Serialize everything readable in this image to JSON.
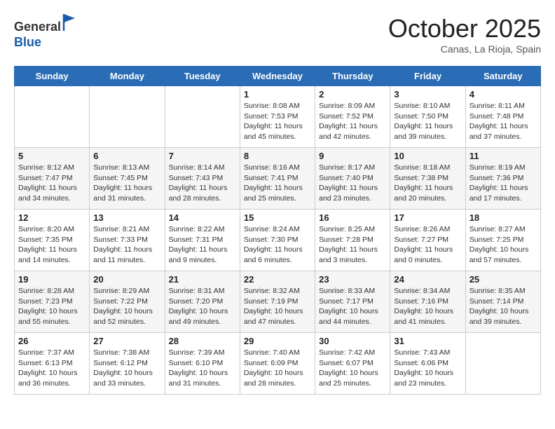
{
  "header": {
    "logo_line1": "General",
    "logo_line2": "Blue",
    "month": "October 2025",
    "location": "Canas, La Rioja, Spain"
  },
  "weekdays": [
    "Sunday",
    "Monday",
    "Tuesday",
    "Wednesday",
    "Thursday",
    "Friday",
    "Saturday"
  ],
  "weeks": [
    [
      {
        "day": "",
        "info": ""
      },
      {
        "day": "",
        "info": ""
      },
      {
        "day": "",
        "info": ""
      },
      {
        "day": "1",
        "info": "Sunrise: 8:08 AM\nSunset: 7:53 PM\nDaylight: 11 hours\nand 45 minutes."
      },
      {
        "day": "2",
        "info": "Sunrise: 8:09 AM\nSunset: 7:52 PM\nDaylight: 11 hours\nand 42 minutes."
      },
      {
        "day": "3",
        "info": "Sunrise: 8:10 AM\nSunset: 7:50 PM\nDaylight: 11 hours\nand 39 minutes."
      },
      {
        "day": "4",
        "info": "Sunrise: 8:11 AM\nSunset: 7:48 PM\nDaylight: 11 hours\nand 37 minutes."
      }
    ],
    [
      {
        "day": "5",
        "info": "Sunrise: 8:12 AM\nSunset: 7:47 PM\nDaylight: 11 hours\nand 34 minutes."
      },
      {
        "day": "6",
        "info": "Sunrise: 8:13 AM\nSunset: 7:45 PM\nDaylight: 11 hours\nand 31 minutes."
      },
      {
        "day": "7",
        "info": "Sunrise: 8:14 AM\nSunset: 7:43 PM\nDaylight: 11 hours\nand 28 minutes."
      },
      {
        "day": "8",
        "info": "Sunrise: 8:16 AM\nSunset: 7:41 PM\nDaylight: 11 hours\nand 25 minutes."
      },
      {
        "day": "9",
        "info": "Sunrise: 8:17 AM\nSunset: 7:40 PM\nDaylight: 11 hours\nand 23 minutes."
      },
      {
        "day": "10",
        "info": "Sunrise: 8:18 AM\nSunset: 7:38 PM\nDaylight: 11 hours\nand 20 minutes."
      },
      {
        "day": "11",
        "info": "Sunrise: 8:19 AM\nSunset: 7:36 PM\nDaylight: 11 hours\nand 17 minutes."
      }
    ],
    [
      {
        "day": "12",
        "info": "Sunrise: 8:20 AM\nSunset: 7:35 PM\nDaylight: 11 hours\nand 14 minutes."
      },
      {
        "day": "13",
        "info": "Sunrise: 8:21 AM\nSunset: 7:33 PM\nDaylight: 11 hours\nand 11 minutes."
      },
      {
        "day": "14",
        "info": "Sunrise: 8:22 AM\nSunset: 7:31 PM\nDaylight: 11 hours\nand 9 minutes."
      },
      {
        "day": "15",
        "info": "Sunrise: 8:24 AM\nSunset: 7:30 PM\nDaylight: 11 hours\nand 6 minutes."
      },
      {
        "day": "16",
        "info": "Sunrise: 8:25 AM\nSunset: 7:28 PM\nDaylight: 11 hours\nand 3 minutes."
      },
      {
        "day": "17",
        "info": "Sunrise: 8:26 AM\nSunset: 7:27 PM\nDaylight: 11 hours\nand 0 minutes."
      },
      {
        "day": "18",
        "info": "Sunrise: 8:27 AM\nSunset: 7:25 PM\nDaylight: 10 hours\nand 57 minutes."
      }
    ],
    [
      {
        "day": "19",
        "info": "Sunrise: 8:28 AM\nSunset: 7:23 PM\nDaylight: 10 hours\nand 55 minutes."
      },
      {
        "day": "20",
        "info": "Sunrise: 8:29 AM\nSunset: 7:22 PM\nDaylight: 10 hours\nand 52 minutes."
      },
      {
        "day": "21",
        "info": "Sunrise: 8:31 AM\nSunset: 7:20 PM\nDaylight: 10 hours\nand 49 minutes."
      },
      {
        "day": "22",
        "info": "Sunrise: 8:32 AM\nSunset: 7:19 PM\nDaylight: 10 hours\nand 47 minutes."
      },
      {
        "day": "23",
        "info": "Sunrise: 8:33 AM\nSunset: 7:17 PM\nDaylight: 10 hours\nand 44 minutes."
      },
      {
        "day": "24",
        "info": "Sunrise: 8:34 AM\nSunset: 7:16 PM\nDaylight: 10 hours\nand 41 minutes."
      },
      {
        "day": "25",
        "info": "Sunrise: 8:35 AM\nSunset: 7:14 PM\nDaylight: 10 hours\nand 39 minutes."
      }
    ],
    [
      {
        "day": "26",
        "info": "Sunrise: 7:37 AM\nSunset: 6:13 PM\nDaylight: 10 hours\nand 36 minutes."
      },
      {
        "day": "27",
        "info": "Sunrise: 7:38 AM\nSunset: 6:12 PM\nDaylight: 10 hours\nand 33 minutes."
      },
      {
        "day": "28",
        "info": "Sunrise: 7:39 AM\nSunset: 6:10 PM\nDaylight: 10 hours\nand 31 minutes."
      },
      {
        "day": "29",
        "info": "Sunrise: 7:40 AM\nSunset: 6:09 PM\nDaylight: 10 hours\nand 28 minutes."
      },
      {
        "day": "30",
        "info": "Sunrise: 7:42 AM\nSunset: 6:07 PM\nDaylight: 10 hours\nand 25 minutes."
      },
      {
        "day": "31",
        "info": "Sunrise: 7:43 AM\nSunset: 6:06 PM\nDaylight: 10 hours\nand 23 minutes."
      },
      {
        "day": "",
        "info": ""
      }
    ]
  ]
}
